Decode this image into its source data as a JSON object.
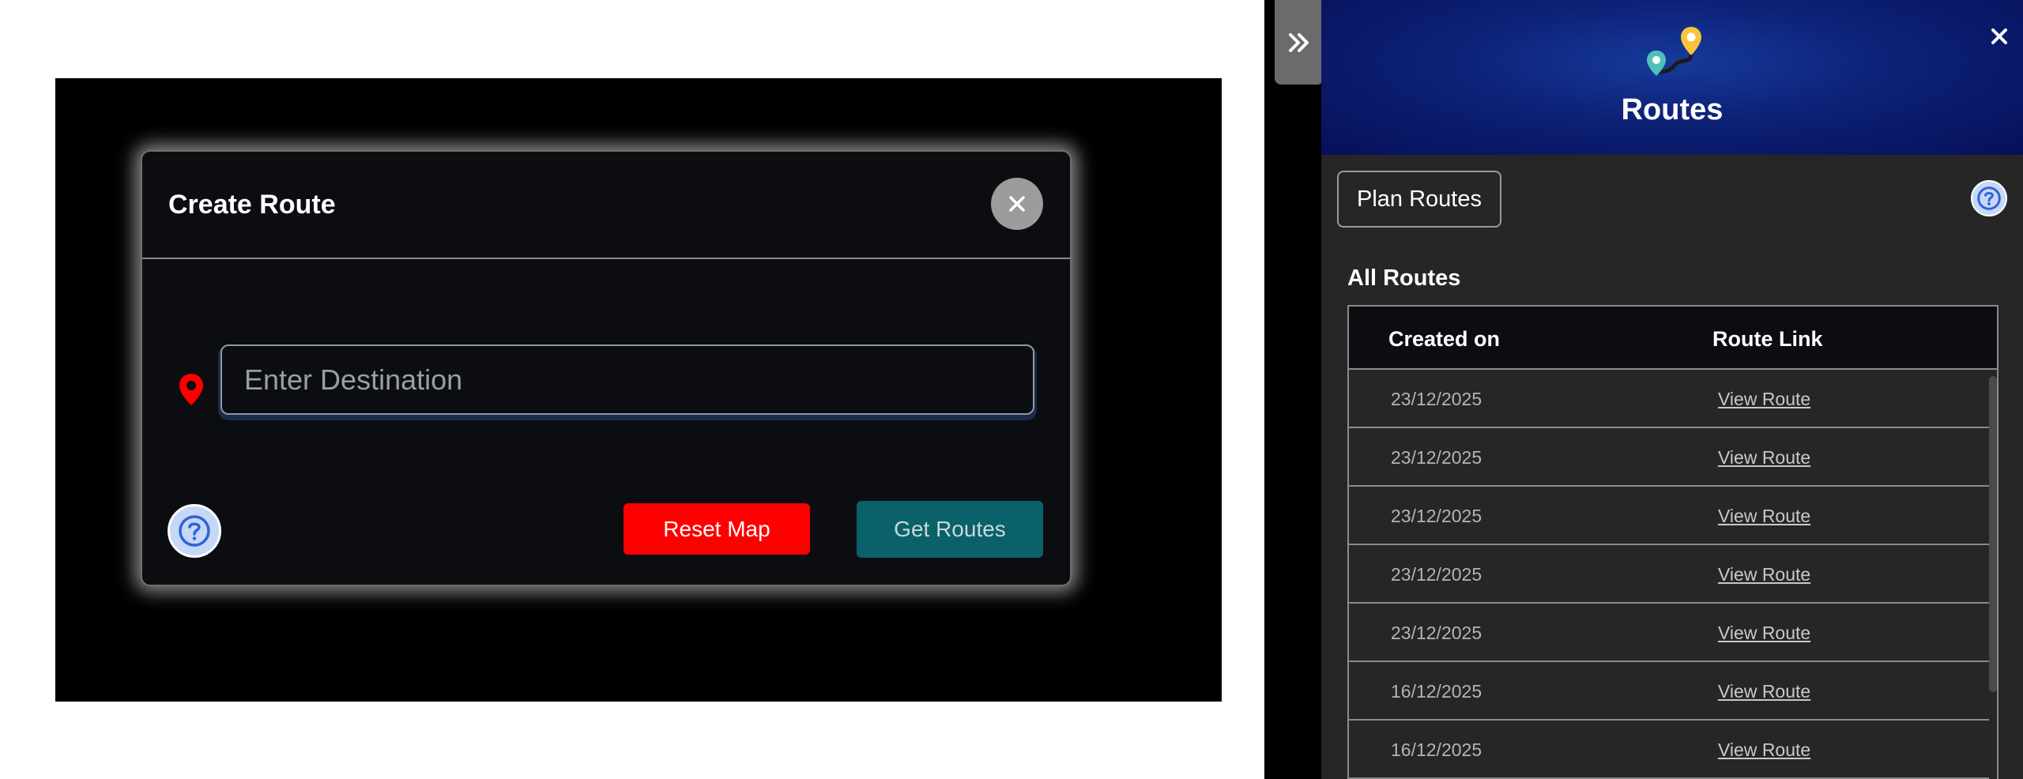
{
  "modal": {
    "title": "Create Route",
    "destination_placeholder": "Enter Destination",
    "destination_value": "",
    "reset_label": "Reset Map",
    "get_routes_label": "Get Routes"
  },
  "panel": {
    "title": "Routes",
    "plan_routes_label": "Plan Routes",
    "all_routes_label": "All Routes",
    "columns": {
      "created_on": "Created on",
      "route_link": "Route Link"
    },
    "rows": [
      {
        "date": "23/12/2025",
        "link": "View Route"
      },
      {
        "date": "23/12/2025",
        "link": "View Route"
      },
      {
        "date": "23/12/2025",
        "link": "View Route"
      },
      {
        "date": "23/12/2025",
        "link": "View Route"
      },
      {
        "date": "23/12/2025",
        "link": "View Route"
      },
      {
        "date": "16/12/2025",
        "link": "View Route"
      },
      {
        "date": "16/12/2025",
        "link": "View Route"
      }
    ]
  },
  "icons": {
    "modal_close": "close-icon",
    "destination_pin": "location-pin-icon",
    "help": "question-circle-icon",
    "panel_toggle": "double-chevron-right-icon",
    "panel_close": "close-icon",
    "panel_logo": "route-map-pins-icon"
  },
  "colors": {
    "reset_button": "#ff0000",
    "get_routes_button": "#0a6169",
    "panel_header": "#0d2176",
    "pin_red": "#ff0000"
  }
}
